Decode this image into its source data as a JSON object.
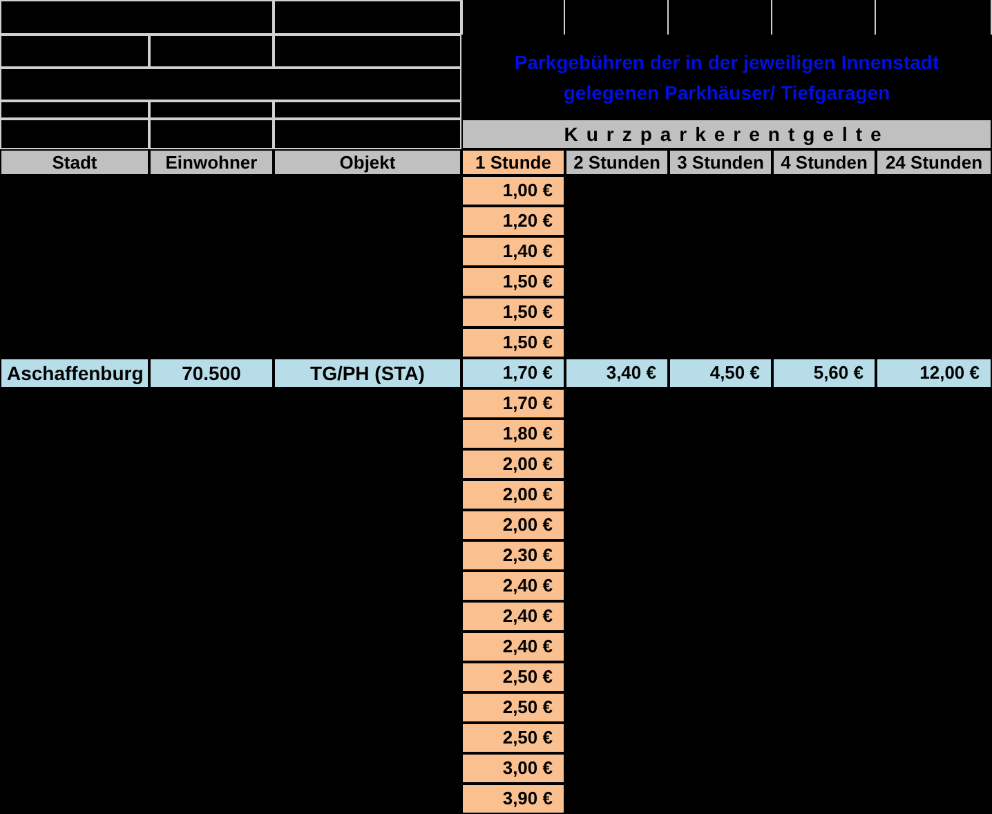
{
  "title": "Parkgebühren der in der jeweiligen Innenstadt gelegenen Parkhäuser/ Tiefgaragen",
  "group_header": "Kurzparkerentgelte",
  "columns": [
    {
      "label": "Stadt",
      "selected": false
    },
    {
      "label": "Einwohner",
      "selected": false
    },
    {
      "label": "Objekt",
      "selected": false
    },
    {
      "label": "1 Stunde",
      "selected": true
    },
    {
      "label": "2 Stunden",
      "selected": false
    },
    {
      "label": "3 Stunden",
      "selected": false
    },
    {
      "label": "4 Stunden",
      "selected": false
    },
    {
      "label": "24 Stunden",
      "selected": false
    }
  ],
  "rows": [
    {
      "selected": false,
      "cells": [
        "",
        "",
        "",
        "1,00 €",
        "",
        "",
        "",
        ""
      ]
    },
    {
      "selected": false,
      "cells": [
        "",
        "",
        "",
        "1,20 €",
        "",
        "",
        "",
        ""
      ]
    },
    {
      "selected": false,
      "cells": [
        "",
        "",
        "",
        "1,40 €",
        "",
        "",
        "",
        ""
      ]
    },
    {
      "selected": false,
      "cells": [
        "",
        "",
        "",
        "1,50 €",
        "",
        "",
        "",
        ""
      ]
    },
    {
      "selected": false,
      "cells": [
        "",
        "",
        "",
        "1,50 €",
        "",
        "",
        "",
        ""
      ]
    },
    {
      "selected": false,
      "cells": [
        "",
        "",
        "",
        "1,50 €",
        "",
        "",
        "",
        ""
      ]
    },
    {
      "selected": true,
      "cells": [
        "Aschaffenburg",
        "70.500",
        "TG/PH (STA)",
        "1,70 €",
        "3,40 €",
        "4,50 €",
        "5,60 €",
        "12,00 €"
      ]
    },
    {
      "selected": false,
      "cells": [
        "",
        "",
        "",
        "1,70 €",
        "",
        "",
        "",
        ""
      ]
    },
    {
      "selected": false,
      "cells": [
        "",
        "",
        "",
        "1,80 €",
        "",
        "",
        "",
        ""
      ]
    },
    {
      "selected": false,
      "cells": [
        "",
        "",
        "",
        "2,00 €",
        "",
        "",
        "",
        ""
      ]
    },
    {
      "selected": false,
      "cells": [
        "",
        "",
        "",
        "2,00 €",
        "",
        "",
        "",
        ""
      ]
    },
    {
      "selected": false,
      "cells": [
        "",
        "",
        "",
        "2,00 €",
        "",
        "",
        "",
        ""
      ]
    },
    {
      "selected": false,
      "cells": [
        "",
        "",
        "",
        "2,30 €",
        "",
        "",
        "",
        ""
      ]
    },
    {
      "selected": false,
      "cells": [
        "",
        "",
        "",
        "2,40 €",
        "",
        "",
        "",
        ""
      ]
    },
    {
      "selected": false,
      "cells": [
        "",
        "",
        "",
        "2,40 €",
        "",
        "",
        "",
        ""
      ]
    },
    {
      "selected": false,
      "cells": [
        "",
        "",
        "",
        "2,40 €",
        "",
        "",
        "",
        ""
      ]
    },
    {
      "selected": false,
      "cells": [
        "",
        "",
        "",
        "2,50 €",
        "",
        "",
        "",
        ""
      ]
    },
    {
      "selected": false,
      "cells": [
        "",
        "",
        "",
        "2,50 €",
        "",
        "",
        "",
        ""
      ]
    },
    {
      "selected": false,
      "cells": [
        "",
        "",
        "",
        "2,50 €",
        "",
        "",
        "",
        ""
      ]
    },
    {
      "selected": false,
      "cells": [
        "",
        "",
        "",
        "3,00 €",
        "",
        "",
        "",
        ""
      ]
    },
    {
      "selected": false,
      "cells": [
        "",
        "",
        "",
        "3,90 €",
        "",
        "",
        "",
        ""
      ]
    }
  ]
}
